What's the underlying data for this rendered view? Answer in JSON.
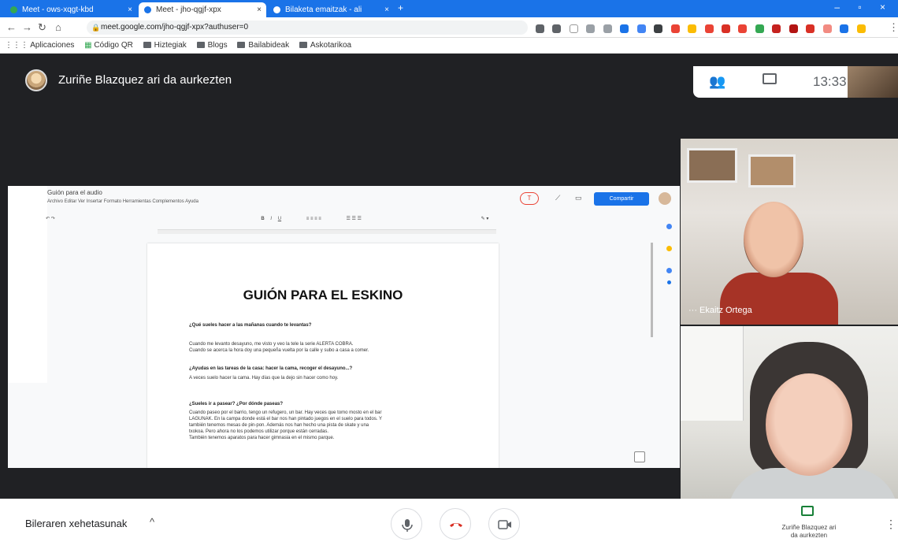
{
  "browser": {
    "tabs": [
      {
        "title": "Meet - ows-xqgt-kbd",
        "active": false
      },
      {
        "title": "Meet - jho-qgjf-xpx",
        "active": true
      },
      {
        "title": "Bilaketa emaitzak - ali",
        "active": false
      }
    ],
    "url": "meet.google.com/jho-qgjf-xpx?authuser=0",
    "bookmarks": [
      "Aplicaciones",
      "Código QR",
      "Hiztegiak",
      "Blogs",
      "Bailabideak",
      "Askotarikoa"
    ]
  },
  "meet": {
    "presenter_banner": "Zuriñe Blazquez ari da aurkezten",
    "clock": "13:33",
    "participants": [
      {
        "name": "Ekaitz Ortega"
      },
      {
        "name": ""
      }
    ],
    "bottom": {
      "details_label": "Bileraren xehetasunak",
      "presenting_label": "Zuriñe Blazquez ari da aurkezten"
    }
  },
  "doc": {
    "title": "Guión para el audio",
    "menu": "Archivo  Editar  Ver  Insertar  Formato  Herramientas  Complementos  Ayuda",
    "share_label": "Compartir",
    "heading": "GUIÓN PARA EL ESKINO",
    "blocks": [
      {
        "q": "¿Qué sueles hacer a las mañanas cuando te levantas?",
        "a": [
          "Cuando me levanto desayuno, me visto y veo la tele la serie ALERTA COBRA.",
          "Cuando se acerca la hora doy una pequeña vuelta por la calle y subo a casa a comer."
        ]
      },
      {
        "q": "¿Ayudas en las tareas de la casa: hacer la cama, recoger el desayuno...?",
        "a": [
          "A veces suelo hacer la cama. Hay días que la dejo sin hacer como hoy."
        ]
      },
      {
        "q": "¿Sueles ir a pasear? ¿Por dónde paseas?",
        "a": [
          "Cuando paseo por el barrio, tengo un refugero, un bar. Hay veces que tomo mosto en el bar",
          "LAGUNAK. En la campa donde está el bar nos han pintado juegos en el suelo para todos. Y",
          "también tenemos mesas de pin-pon. Además nos han hecho una pista de skate y una",
          "txokoa. Pero ahora no los podemos utilizar porque están cerradas.",
          "También tenemos aparatos para hacer gimnasia en el mismo parque."
        ]
      }
    ]
  }
}
